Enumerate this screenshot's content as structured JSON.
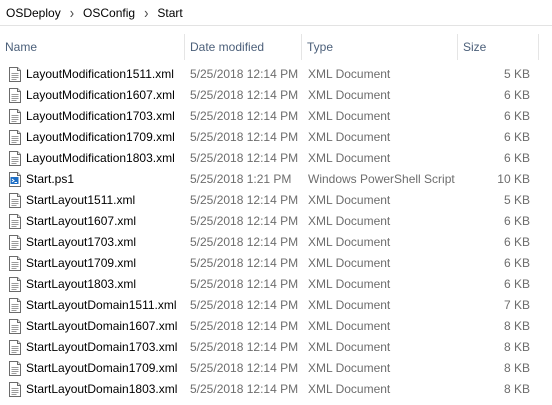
{
  "breadcrumb": [
    "OSDeploy",
    "OSConfig",
    "Start"
  ],
  "columns": {
    "name": "Name",
    "date": "Date modified",
    "type": "Type",
    "size": "Size"
  },
  "files": [
    {
      "name": "LayoutModification1511.xml",
      "date": "5/25/2018 12:14 PM",
      "type": "XML Document",
      "size": "5 KB",
      "icon": "xml-file-icon"
    },
    {
      "name": "LayoutModification1607.xml",
      "date": "5/25/2018 12:14 PM",
      "type": "XML Document",
      "size": "6 KB",
      "icon": "xml-file-icon"
    },
    {
      "name": "LayoutModification1703.xml",
      "date": "5/25/2018 12:14 PM",
      "type": "XML Document",
      "size": "6 KB",
      "icon": "xml-file-icon"
    },
    {
      "name": "LayoutModification1709.xml",
      "date": "5/25/2018 12:14 PM",
      "type": "XML Document",
      "size": "6 KB",
      "icon": "xml-file-icon"
    },
    {
      "name": "LayoutModification1803.xml",
      "date": "5/25/2018 12:14 PM",
      "type": "XML Document",
      "size": "6 KB",
      "icon": "xml-file-icon"
    },
    {
      "name": "Start.ps1",
      "date": "5/25/2018 1:21 PM",
      "type": "Windows PowerShell Script",
      "size": "10 KB",
      "icon": "powershell-script-icon"
    },
    {
      "name": "StartLayout1511.xml",
      "date": "5/25/2018 12:14 PM",
      "type": "XML Document",
      "size": "5 KB",
      "icon": "xml-file-icon"
    },
    {
      "name": "StartLayout1607.xml",
      "date": "5/25/2018 12:14 PM",
      "type": "XML Document",
      "size": "6 KB",
      "icon": "xml-file-icon"
    },
    {
      "name": "StartLayout1703.xml",
      "date": "5/25/2018 12:14 PM",
      "type": "XML Document",
      "size": "6 KB",
      "icon": "xml-file-icon"
    },
    {
      "name": "StartLayout1709.xml",
      "date": "5/25/2018 12:14 PM",
      "type": "XML Document",
      "size": "6 KB",
      "icon": "xml-file-icon"
    },
    {
      "name": "StartLayout1803.xml",
      "date": "5/25/2018 12:14 PM",
      "type": "XML Document",
      "size": "6 KB",
      "icon": "xml-file-icon"
    },
    {
      "name": "StartLayoutDomain1511.xml",
      "date": "5/25/2018 12:14 PM",
      "type": "XML Document",
      "size": "7 KB",
      "icon": "xml-file-icon"
    },
    {
      "name": "StartLayoutDomain1607.xml",
      "date": "5/25/2018 12:14 PM",
      "type": "XML Document",
      "size": "8 KB",
      "icon": "xml-file-icon"
    },
    {
      "name": "StartLayoutDomain1703.xml",
      "date": "5/25/2018 12:14 PM",
      "type": "XML Document",
      "size": "8 KB",
      "icon": "xml-file-icon"
    },
    {
      "name": "StartLayoutDomain1709.xml",
      "date": "5/25/2018 12:14 PM",
      "type": "XML Document",
      "size": "8 KB",
      "icon": "xml-file-icon"
    },
    {
      "name": "StartLayoutDomain1803.xml",
      "date": "5/25/2018 12:14 PM",
      "type": "XML Document",
      "size": "8 KB",
      "icon": "xml-file-icon"
    }
  ],
  "colors": {
    "header_text": "#4c607a",
    "detail_text": "#6d6d6d",
    "ps_icon_blue": "#1f6fc5"
  }
}
